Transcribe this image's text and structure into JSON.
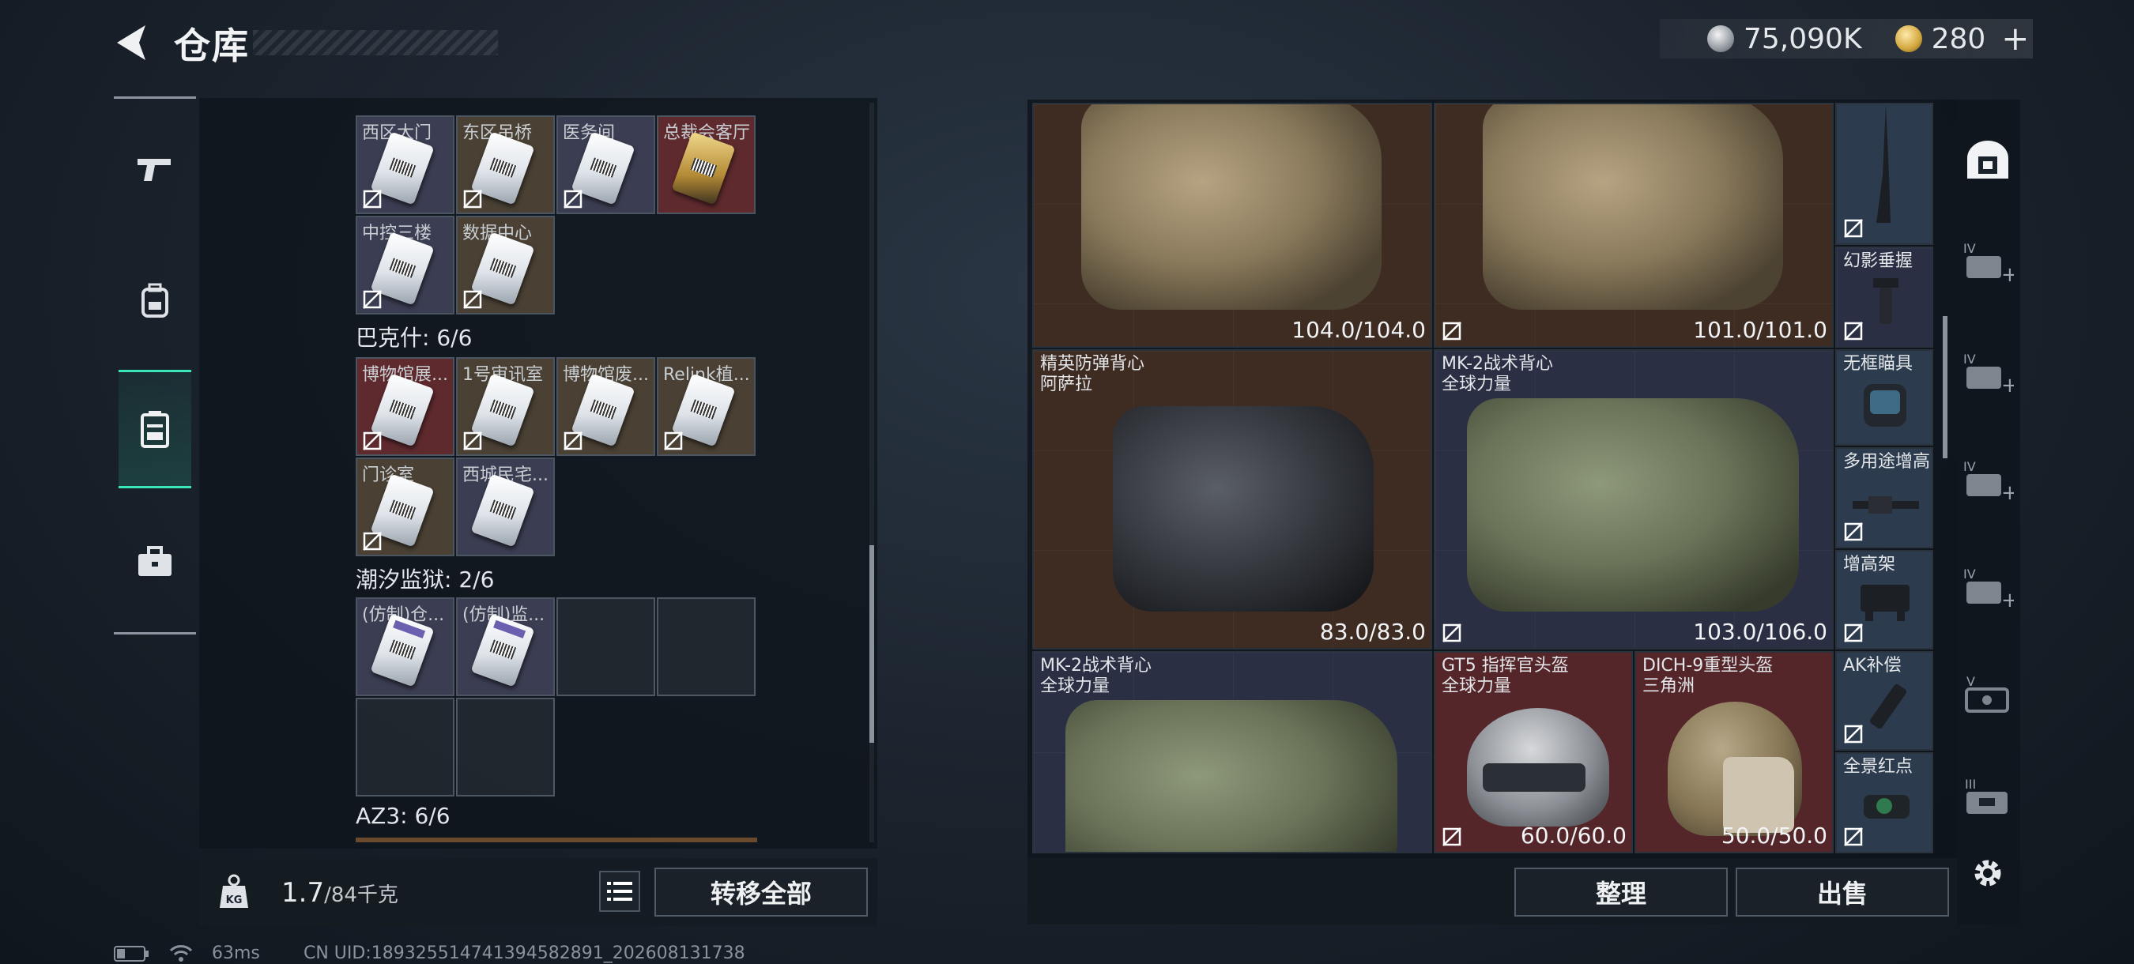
{
  "header": {
    "title": "仓库",
    "currency_primary": "75,090K",
    "currency_secondary": "280",
    "plus_label": "+"
  },
  "tabs": [
    {
      "name": "weapons",
      "icon": "pistol-icon"
    },
    {
      "name": "equipment",
      "icon": "backpack-icon"
    },
    {
      "name": "containers",
      "icon": "case-icon"
    },
    {
      "name": "items",
      "icon": "toolbox-icon"
    }
  ],
  "left_panel": {
    "sections": [
      {
        "title": "",
        "cards": [
          {
            "label": "西区大门",
            "color": "blue",
            "art": "white"
          },
          {
            "label": "东区吊桥",
            "color": "tan",
            "art": "white"
          },
          {
            "label": "医务间",
            "color": "blue",
            "art": "white"
          },
          {
            "label": "总裁会客厅",
            "color": "red",
            "art": "gold"
          },
          {
            "label": "中控三楼",
            "color": "blue",
            "art": "white"
          },
          {
            "label": "数据中心",
            "color": "tan",
            "art": "white"
          }
        ]
      },
      {
        "title": "巴克什: 6/6",
        "cards": [
          {
            "label": "博物馆展...",
            "color": "red",
            "art": "white"
          },
          {
            "label": "1号审讯室",
            "color": "tan",
            "art": "white"
          },
          {
            "label": "博物馆废...",
            "color": "tan",
            "art": "white"
          },
          {
            "label": "Relink植...",
            "color": "tan",
            "art": "white"
          },
          {
            "label": "门诊室",
            "color": "tan",
            "art": "white"
          },
          {
            "label": "西城民宅...",
            "color": "blue",
            "art": "white"
          }
        ]
      },
      {
        "title": "潮汐监狱: 2/6",
        "cards": [
          {
            "label": "(仿制)仓...",
            "color": "blue",
            "art": "purple"
          },
          {
            "label": "(仿制)监...",
            "color": "blue",
            "art": "purple"
          }
        ]
      },
      {
        "title": "AZ3: 6/6",
        "cards": []
      }
    ],
    "weight_current": "1.7",
    "weight_max": "/84千克",
    "transfer_all_label": "转移全部"
  },
  "right_panel": {
    "items": [
      {
        "name": "",
        "durability": "104.0/104.0",
        "kind": "vest-desert"
      },
      {
        "name": "",
        "durability": "101.0/101.0",
        "kind": "vest-desert"
      },
      {
        "name": "精英防弹背心\n阿萨拉",
        "durability": "83.0/83.0",
        "kind": "vest-black"
      },
      {
        "name": "MK-2战术背心\n全球力量",
        "durability": "103.0/106.0",
        "kind": "vest-green"
      },
      {
        "name": "MK-2战术背心\n全球力量",
        "durability": "",
        "kind": "vest-green"
      },
      {
        "name": "GT5 指挥官头盔\n全球力量",
        "durability": "60.0/60.0",
        "kind": "helmet-gt5"
      },
      {
        "name": "DICH-9重型头盔\n三角洲",
        "durability": "50.0/50.0",
        "kind": "helmet-dich"
      }
    ],
    "attachments": [
      {
        "name": "",
        "icon": "sling-icon"
      },
      {
        "name": "幻影垂握",
        "icon": "grip-icon"
      },
      {
        "name": "无框瞄具",
        "icon": "sight-icon"
      },
      {
        "name": "多用途增高",
        "icon": "riser-icon"
      },
      {
        "name": "增高架",
        "icon": "mount-icon"
      },
      {
        "name": "AK补偿",
        "icon": "compensator-icon"
      },
      {
        "name": "全景红点",
        "icon": "reddot-icon"
      }
    ],
    "sort_label": "整理",
    "sell_label": "出售"
  },
  "side_buttons": [
    {
      "icon": "safe-box-icon",
      "tier": ""
    },
    {
      "icon": "add-container-icon",
      "tier": "IV"
    },
    {
      "icon": "add-container-icon",
      "tier": "IV"
    },
    {
      "icon": "add-container-icon",
      "tier": "IV"
    },
    {
      "icon": "add-container-icon",
      "tier": "IV"
    },
    {
      "icon": "container-icon",
      "tier": "V"
    },
    {
      "icon": "container-icon",
      "tier": "III"
    }
  ],
  "status_bar": {
    "ping": "63ms",
    "uid": "CN UID:189325514741394582891_202608131738"
  }
}
